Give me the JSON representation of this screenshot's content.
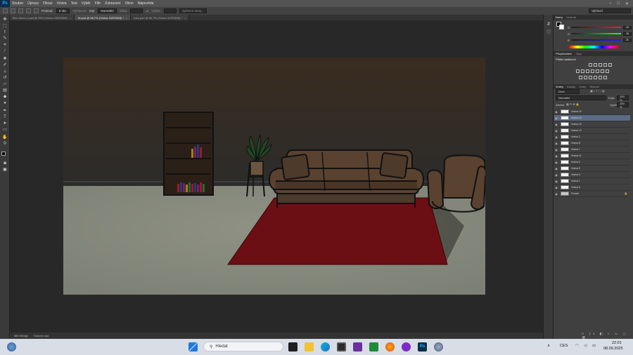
{
  "menubar": {
    "logo": "Ps",
    "items": [
      "Soubor",
      "Úpravy",
      "Obraz",
      "Vrstva",
      "Text",
      "Výběr",
      "Filtr",
      "Zobrazení",
      "Okno",
      "Nápověda"
    ]
  },
  "options": {
    "feather_label": "Prolnutí:",
    "feather_value": "0 obr.",
    "antialias_label": "Vyhlazení",
    "style_label": "Styl:",
    "style_value": "Normální",
    "width_label": "Šířka:",
    "height_label": "Výška:",
    "refine_label": "Zpřesnit okraj...",
    "workspace": "Výchozí"
  },
  "tabs": [
    {
      "label": "Bez názvu-1.psd @ 25% (Vrstva 19/RGB/8)",
      "active": false
    },
    {
      "label": "18.psd @ 66,7% (Vrstva 16/RGB/8) *",
      "active": true
    },
    {
      "label": "kam.psd @ 66,7% (Vrstva 11/RGB/8) *",
      "active": false
    }
  ],
  "status": {
    "timeline": "Mini Bridge",
    "timeline2": "Časová osa"
  },
  "color_panel": {
    "tabs": [
      "Barvy",
      "Vzorník"
    ],
    "r_label": "R",
    "g_label": "G",
    "b_label": "B",
    "r": "28",
    "g": "28",
    "b": "28"
  },
  "adjust_panel": {
    "tabs": [
      "Přizpůsobení",
      "Styly"
    ],
    "title": "Přidat nastavení"
  },
  "layers_panel": {
    "tabs": [
      "Vrstvy",
      "Kanály",
      "Cesty",
      "Historie"
    ],
    "kind": "Druh",
    "blend": "Normální",
    "opacity_label": "Krytí:",
    "opacity": "100 %",
    "lock_label": "Zámek:",
    "fill_label": "Výplň:",
    "fill": "100 %",
    "layers": [
      {
        "name": "Vrstva 18",
        "selected": false
      },
      {
        "name": "Vrstva 16",
        "selected": true
      },
      {
        "name": "Vrstva 15",
        "selected": false
      },
      {
        "name": "Vrstva 12",
        "selected": false
      },
      {
        "name": "Vrstva 2",
        "selected": false
      },
      {
        "name": "Vrstva 8",
        "selected": false
      },
      {
        "name": "Vrstva 7",
        "selected": false
      },
      {
        "name": "Vrstva 11",
        "selected": false
      },
      {
        "name": "Vrstva 3",
        "selected": false
      },
      {
        "name": "Vrstva 9",
        "selected": false
      },
      {
        "name": "Vrstva 4",
        "selected": false
      },
      {
        "name": "Vrstva 1",
        "selected": false
      },
      {
        "name": "Vrstva 6",
        "selected": false
      },
      {
        "name": "Pozadí",
        "selected": false
      }
    ]
  },
  "taskbar": {
    "search_placeholder": "Hledat",
    "language": "CES",
    "time": "22:01",
    "date": "08.09.2025"
  }
}
